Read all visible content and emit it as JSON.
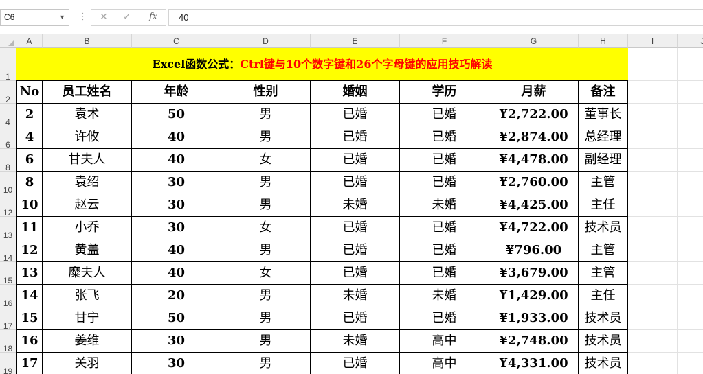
{
  "formula_bar": {
    "name_box": "C6",
    "cancel_icon": "✕",
    "enter_icon": "✓",
    "fx_label": "fx",
    "formula_value": "40"
  },
  "columns": [
    "A",
    "B",
    "C",
    "D",
    "E",
    "F",
    "G",
    "H",
    "I",
    "J"
  ],
  "title": {
    "part1": "Excel函数公式：",
    "part2": "Ctrl键与10个数字键和26个字母键的应用技巧解读",
    "fill_color": "#ffff00",
    "highlight_color": "#ff0000"
  },
  "row_numbers": [
    "1",
    "2",
    "4",
    "6",
    "8",
    "10",
    "12",
    "13",
    "14",
    "15",
    "16",
    "17",
    "18",
    "19"
  ],
  "table": {
    "headers": [
      "No",
      "员工姓名",
      "年龄",
      "性别",
      "婚姻",
      "学历",
      "月薪",
      "备注"
    ],
    "rows": [
      [
        "2",
        "袁术",
        "50",
        "男",
        "已婚",
        "已婚",
        "¥2,722.00",
        "董事长"
      ],
      [
        "4",
        "许攸",
        "40",
        "男",
        "已婚",
        "已婚",
        "¥2,874.00",
        "总经理"
      ],
      [
        "6",
        "甘夫人",
        "40",
        "女",
        "已婚",
        "已婚",
        "¥4,478.00",
        "副经理"
      ],
      [
        "8",
        "袁绍",
        "30",
        "男",
        "已婚",
        "已婚",
        "¥2,760.00",
        "主管"
      ],
      [
        "10",
        "赵云",
        "30",
        "男",
        "未婚",
        "未婚",
        "¥4,425.00",
        "主任"
      ],
      [
        "11",
        "小乔",
        "30",
        "女",
        "已婚",
        "已婚",
        "¥4,722.00",
        "技术员"
      ],
      [
        "12",
        "黄盖",
        "40",
        "男",
        "已婚",
        "已婚",
        "¥796.00",
        "主管"
      ],
      [
        "13",
        "糜夫人",
        "40",
        "女",
        "已婚",
        "已婚",
        "¥3,679.00",
        "主管"
      ],
      [
        "14",
        "张飞",
        "20",
        "男",
        "未婚",
        "未婚",
        "¥1,429.00",
        "主任"
      ],
      [
        "15",
        "甘宁",
        "50",
        "男",
        "已婚",
        "已婚",
        "¥1,933.00",
        "技术员"
      ],
      [
        "16",
        "姜维",
        "30",
        "男",
        "未婚",
        "高中",
        "¥2,748.00",
        "技术员"
      ],
      [
        "17",
        "关羽",
        "30",
        "男",
        "已婚",
        "高中",
        "¥4,331.00",
        "技术员"
      ]
    ]
  }
}
